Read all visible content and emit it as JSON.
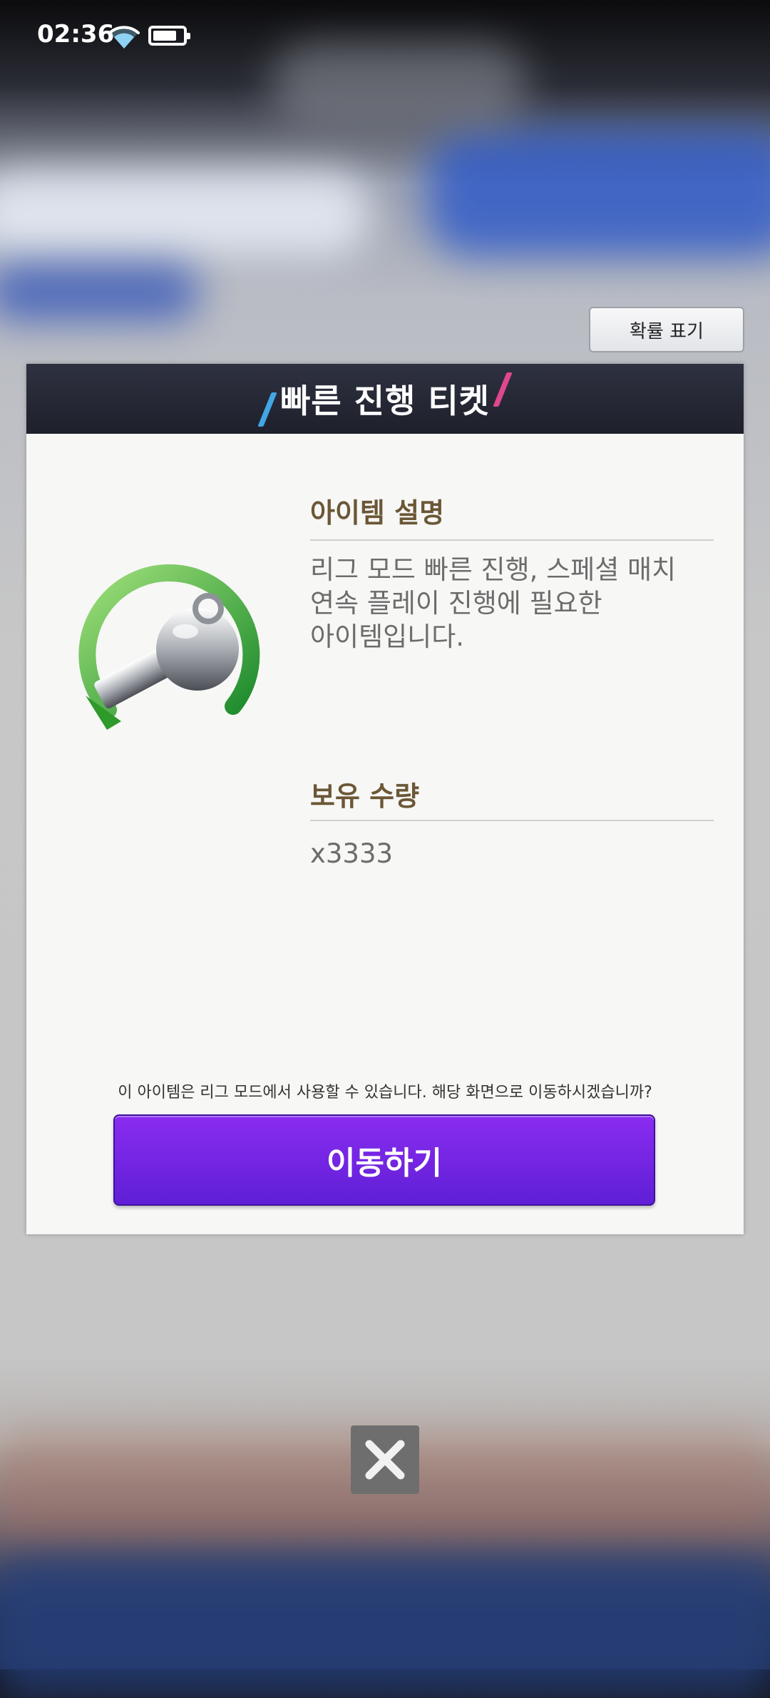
{
  "status_bar": {
    "time": "02:36",
    "battery_level": 0.8,
    "wifi": "wifi-icon",
    "battery": "battery-icon"
  },
  "prob_button": {
    "label": "확률 표기"
  },
  "dialog": {
    "title": "빠른 진행 티켓",
    "desc_heading": "아이템 설명",
    "desc_lines": [
      "리그 모드 빠른 진행, 스페셜 매치",
      "연속 플레이 진행에 필요한",
      "아이템입니다."
    ],
    "qty_heading": "보유 수량",
    "qty_value": "x3333",
    "notice": "이 아이템은 리그 모드에서 사용할 수 있습니다. 해당 화면으로 이동하시겠습니까?",
    "go_button": "이동하기",
    "item_icon": "whistle-icon"
  },
  "close_icon": "close-icon",
  "colors": {
    "header_bg": "#22242f",
    "section_title": "#6b5736",
    "button_purple": "#7a28e6",
    "accent_blue": "#41a6e6",
    "accent_pink": "#e0478f"
  }
}
